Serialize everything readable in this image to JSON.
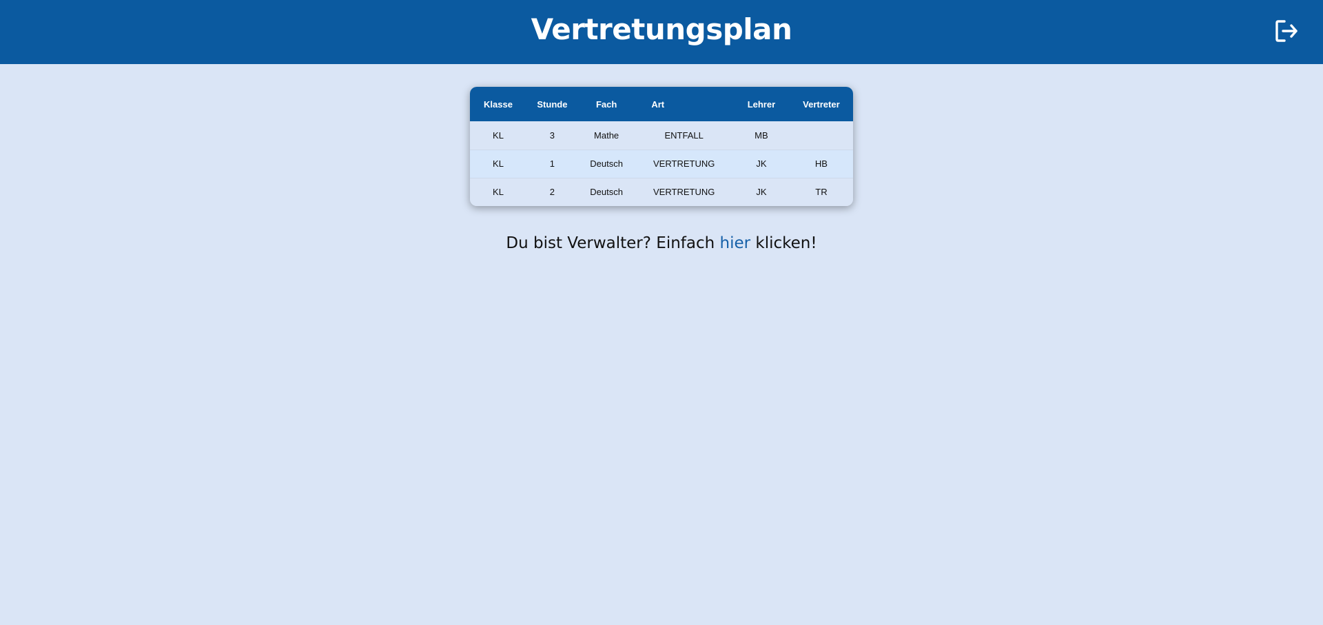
{
  "header": {
    "title": "Vertretungsplan",
    "logout_icon": "logout-icon"
  },
  "table": {
    "columns": [
      "Klasse",
      "Stunde",
      "Fach",
      "Art",
      "Lehrer",
      "Vertreter"
    ],
    "rows": [
      [
        "KL",
        "3",
        "Mathe",
        "ENTFALL",
        "MB",
        ""
      ],
      [
        "KL",
        "1",
        "Deutsch",
        "VERTRETUNG",
        "JK",
        "HB"
      ],
      [
        "KL",
        "2",
        "Deutsch",
        "VERTRETUNG",
        "JK",
        "TR"
      ]
    ]
  },
  "admin": {
    "prefix": "Du bist Verwalter? Einfach ",
    "link_text": "hier",
    "suffix": " klicken!"
  },
  "colors": {
    "header_bg": "#0b5aa0",
    "page_bg": "#dae5f6",
    "link": "#1560a8"
  }
}
